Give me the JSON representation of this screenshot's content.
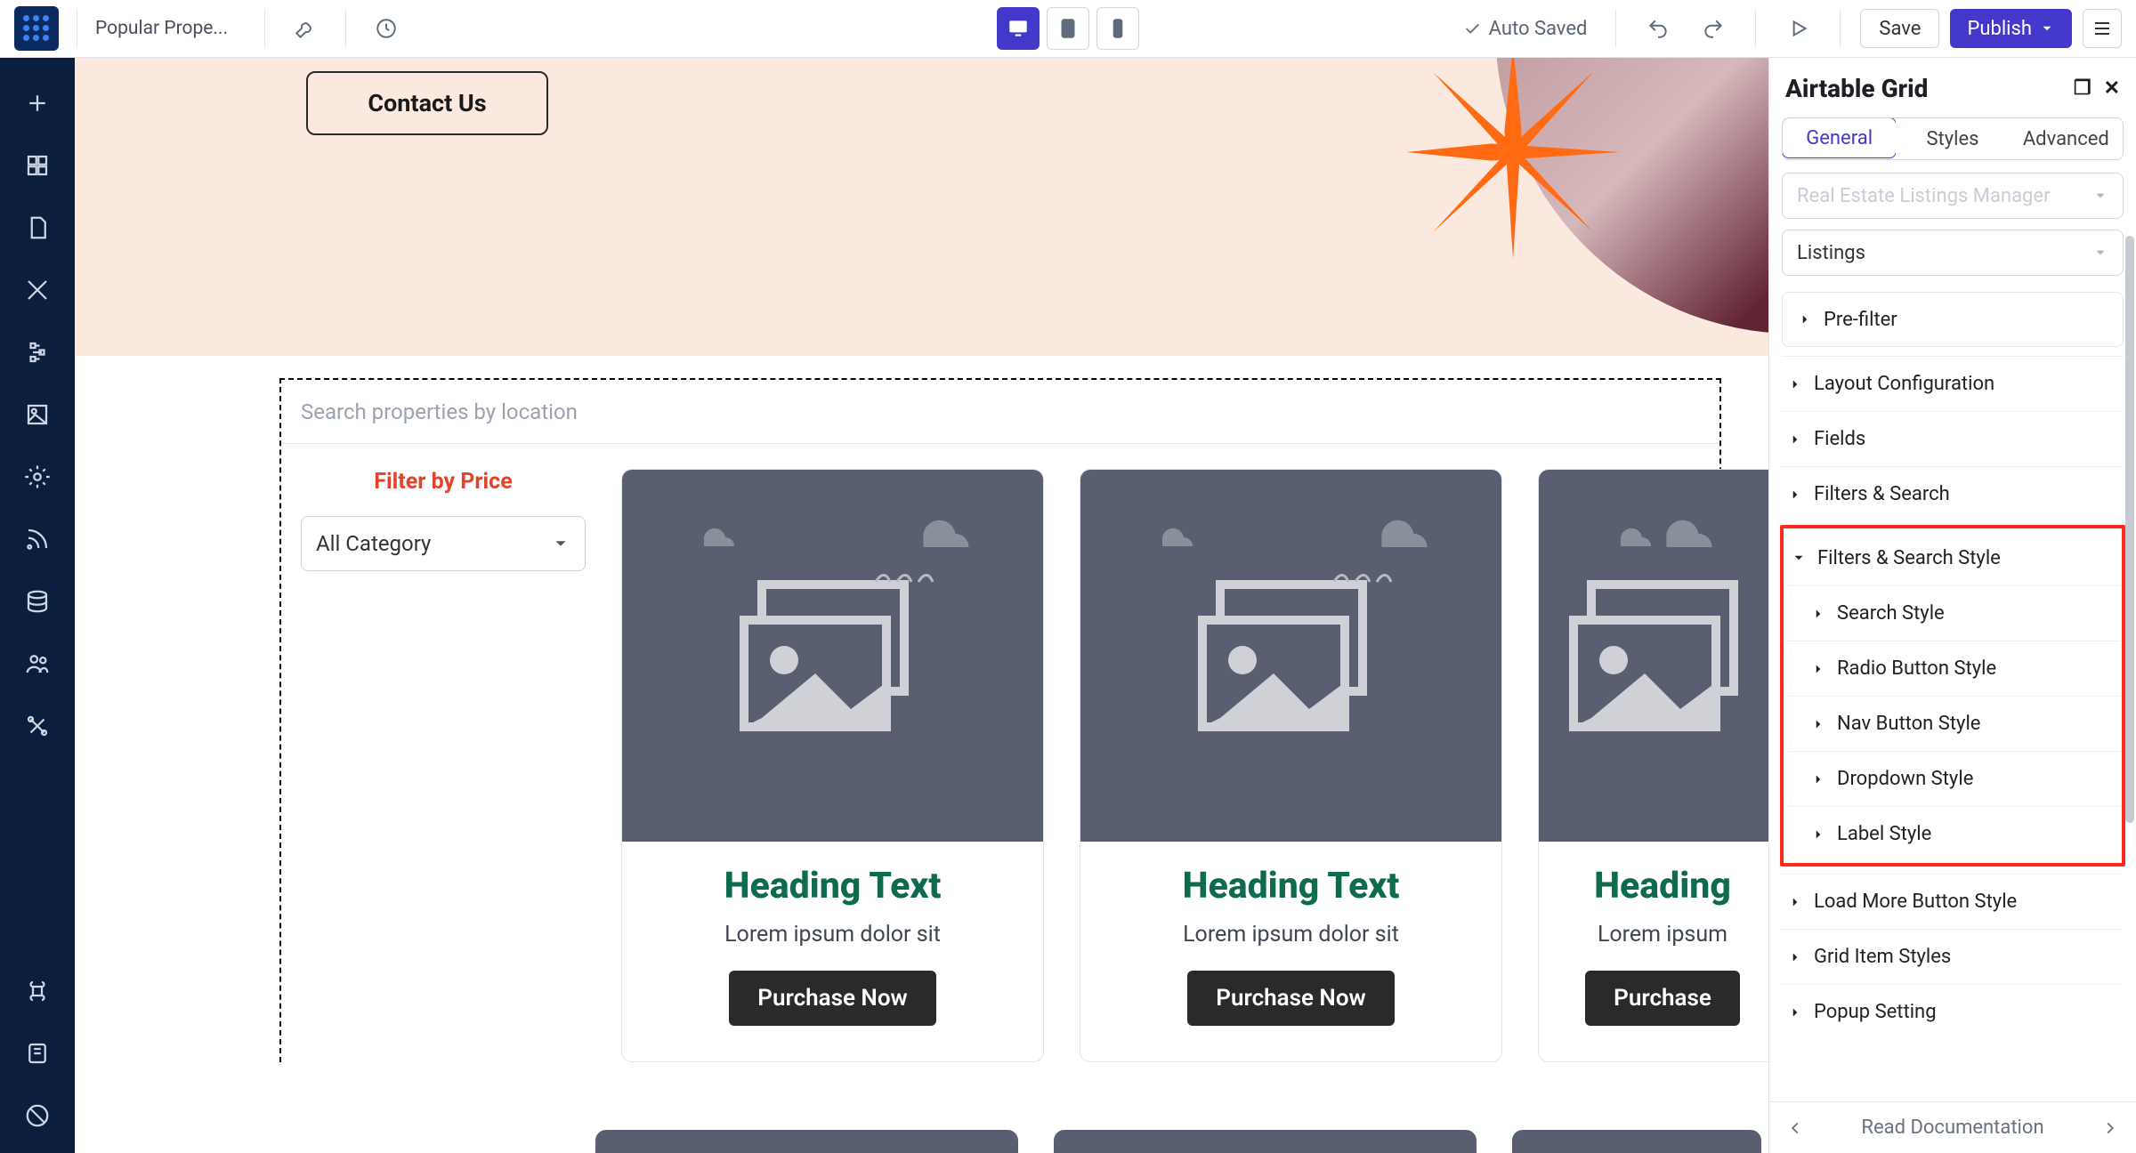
{
  "topbar": {
    "page_title": "Popular Prope...",
    "autosaved": "Auto Saved",
    "save": "Save",
    "publish": "Publish"
  },
  "canvas": {
    "contact": "Contact Us",
    "search_placeholder": "Search properties by location",
    "filter_title": "Filter by Price",
    "filter_select": "All Category",
    "cards": [
      {
        "heading": "Heading Text",
        "lorem": "Lorem ipsum dolor sit",
        "cta": "Purchase Now"
      },
      {
        "heading": "Heading Text",
        "lorem": "Lorem ipsum dolor sit",
        "cta": "Purchase Now"
      },
      {
        "heading": "Heading",
        "lorem": "Lorem ipsum",
        "cta": "Purchase"
      }
    ]
  },
  "inspector": {
    "title": "Airtable Grid",
    "tabs": {
      "general": "General",
      "styles": "Styles",
      "advanced": "Advanced"
    },
    "select1": "Real Estate Listings Manager",
    "select2": "Listings",
    "sections": {
      "prefilter": "Pre-filter",
      "layout": "Layout Configuration",
      "fields": "Fields",
      "filters_search": "Filters & Search",
      "filters_search_style": "Filters & Search Style",
      "search_style": "Search Style",
      "radio_style": "Radio Button Style",
      "nav_style": "Nav Button Style",
      "dropdown_style": "Dropdown Style",
      "label_style": "Label Style",
      "loadmore": "Load More Button Style",
      "griditem": "Grid Item Styles",
      "popup": "Popup Setting"
    },
    "footer": "Read Documentation"
  }
}
